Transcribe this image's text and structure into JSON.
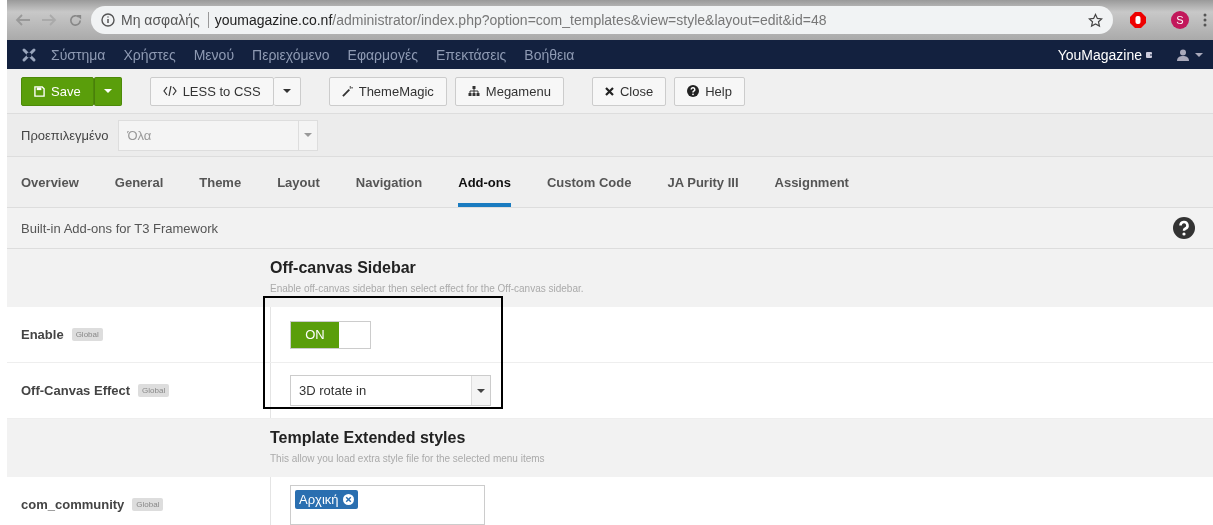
{
  "browser": {
    "security": "Μη ασφαλής",
    "domain": "youmagazine.co.nf",
    "path": "/administrator/index.php?option=com_templates&view=style&layout=edit&id=48",
    "profile_initial": "S"
  },
  "nav": {
    "items": [
      "Σύστημα",
      "Χρήστες",
      "Μενού",
      "Περιεχόμενο",
      "Εφαρμογές",
      "Επεκτάσεις",
      "Βοήθεια"
    ],
    "site_link": "YouMagazine"
  },
  "toolbar": [
    {
      "kind": "save",
      "label": "Save"
    },
    {
      "kind": "split",
      "label": "LESS to CSS"
    },
    {
      "kind": "plain",
      "label": "ThemeMagic"
    },
    {
      "kind": "plain",
      "label": "Megamenu"
    },
    {
      "kind": "plain",
      "label": "Close"
    },
    {
      "kind": "plain",
      "label": "Help"
    }
  ],
  "filter": {
    "label": "Προεπιλεγμένο",
    "value": "Όλα",
    "disabled": true
  },
  "tabs": [
    {
      "label": "Overview",
      "selected": false
    },
    {
      "label": "General",
      "selected": false
    },
    {
      "label": "Theme",
      "selected": false
    },
    {
      "label": "Layout",
      "selected": false
    },
    {
      "label": "Navigation",
      "selected": false
    },
    {
      "label": "Add-ons",
      "selected": true
    },
    {
      "label": "Custom Code",
      "selected": false
    },
    {
      "label": "JA Purity III",
      "selected": false
    },
    {
      "label": "Assignment",
      "selected": false
    }
  ],
  "subheader": "Built-in Add-ons for T3 Framework",
  "sections": [
    {
      "title": "Off-canvas Sidebar",
      "description": "Enable off-canvas sidebar then select effect for the Off-canvas sidebar.",
      "fields": [
        {
          "kind": "toggle",
          "label": "Enable",
          "badge": "Global",
          "value": "ON",
          "on": true
        },
        {
          "kind": "select",
          "label": "Off-Canvas Effect",
          "badge": "Global",
          "value": "3D rotate in"
        }
      ]
    },
    {
      "title": "Template Extended styles",
      "description": "This allow you load extra style file for the selected menu items",
      "fields": [
        {
          "kind": "tags",
          "label": "com_community",
          "badge": "Global",
          "tags": [
            "Αρχική"
          ]
        }
      ]
    }
  ]
}
